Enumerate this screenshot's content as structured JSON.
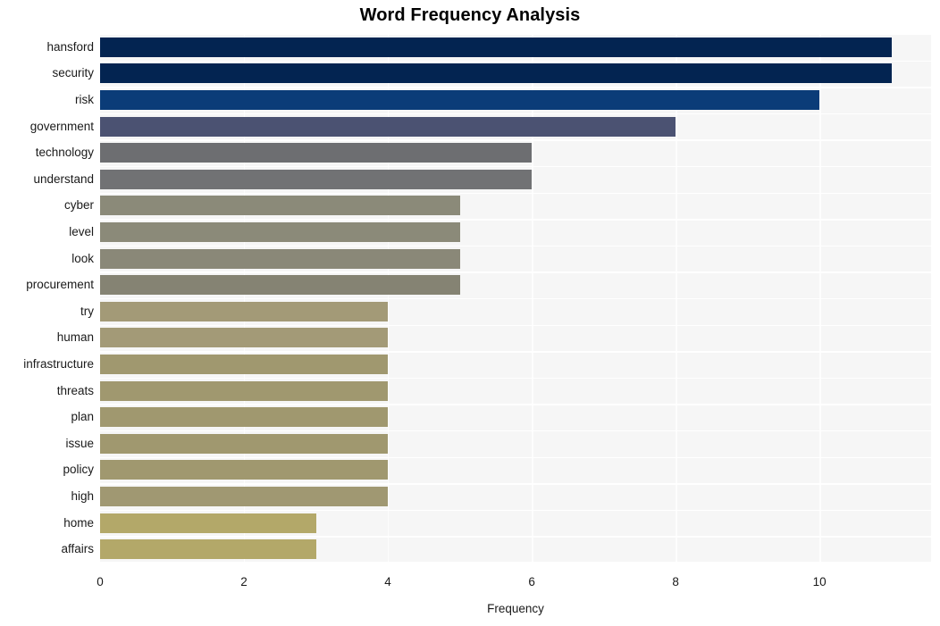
{
  "chart_data": {
    "type": "bar",
    "orientation": "horizontal",
    "title": "Word Frequency Analysis",
    "xlabel": "Frequency",
    "ylabel": "",
    "categories": [
      "hansford",
      "security",
      "risk",
      "government",
      "technology",
      "understand",
      "cyber",
      "level",
      "look",
      "procurement",
      "try",
      "human",
      "infrastructure",
      "threats",
      "plan",
      "issue",
      "policy",
      "high",
      "home",
      "affairs"
    ],
    "values": [
      11,
      11,
      10,
      8,
      6,
      6,
      5,
      5,
      5,
      5,
      4,
      4,
      4,
      4,
      4,
      4,
      4,
      4,
      3,
      3
    ],
    "bar_colors": [
      "#032451",
      "#032451",
      "#0b3c78",
      "#4b5272",
      "#6d6e71",
      "#717274",
      "#8b8a79",
      "#8b8a79",
      "#8a8878",
      "#858373",
      "#a39a77",
      "#a39a77",
      "#a0986f",
      "#a0986f",
      "#a0986f",
      "#a0986f",
      "#a0986f",
      "#a09872",
      "#b3a869",
      "#b3a869"
    ],
    "xlim": [
      0,
      11.55
    ],
    "xticks": [
      0,
      2,
      4,
      6,
      8,
      10
    ],
    "xtick_labels": [
      "0",
      "2",
      "4",
      "6",
      "8",
      "10"
    ],
    "grid": true,
    "grid_color": "#ffffff",
    "plot_background": "#f6f6f6",
    "figure_background": "#ffffff",
    "legend": null
  }
}
